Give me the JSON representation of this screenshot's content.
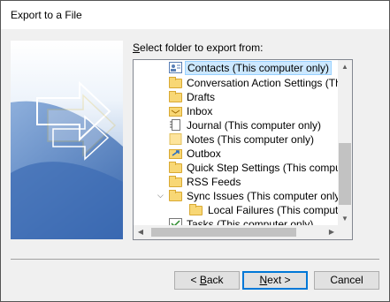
{
  "window": {
    "title": "Export to a File"
  },
  "panel": {
    "label_accesskey": "S",
    "label_rest": "elect folder to export from:"
  },
  "tree": {
    "items": [
      {
        "label": "Contacts (This computer only)",
        "icon": "contacts-icon",
        "selected": true
      },
      {
        "label": "Conversation Action Settings (This c",
        "icon": "folder-icon"
      },
      {
        "label": "Drafts",
        "icon": "folder-icon"
      },
      {
        "label": "Inbox",
        "icon": "inbox-icon"
      },
      {
        "label": "Journal (This computer only)",
        "icon": "journal-icon"
      },
      {
        "label": "Notes (This computer only)",
        "icon": "notes-icon"
      },
      {
        "label": "Outbox",
        "icon": "outbox-icon"
      },
      {
        "label": "Quick Step Settings (This computer o",
        "icon": "folder-icon"
      },
      {
        "label": "RSS Feeds",
        "icon": "folder-icon"
      },
      {
        "label": "Sync Issues (This computer only)",
        "icon": "folder-icon",
        "expanded": true
      },
      {
        "label": "Local Failures (This computer on",
        "icon": "folder-icon"
      },
      {
        "label": "Tasks (This computer only)",
        "icon": "tasks-icon"
      }
    ]
  },
  "buttons": {
    "back_prefix": "< ",
    "back_accesskey": "B",
    "back_rest": "ack",
    "next_accesskey": "N",
    "next_rest": "ext >",
    "cancel": "Cancel"
  },
  "colors": {
    "selection": "#cce8ff",
    "accent": "#0078d7"
  }
}
